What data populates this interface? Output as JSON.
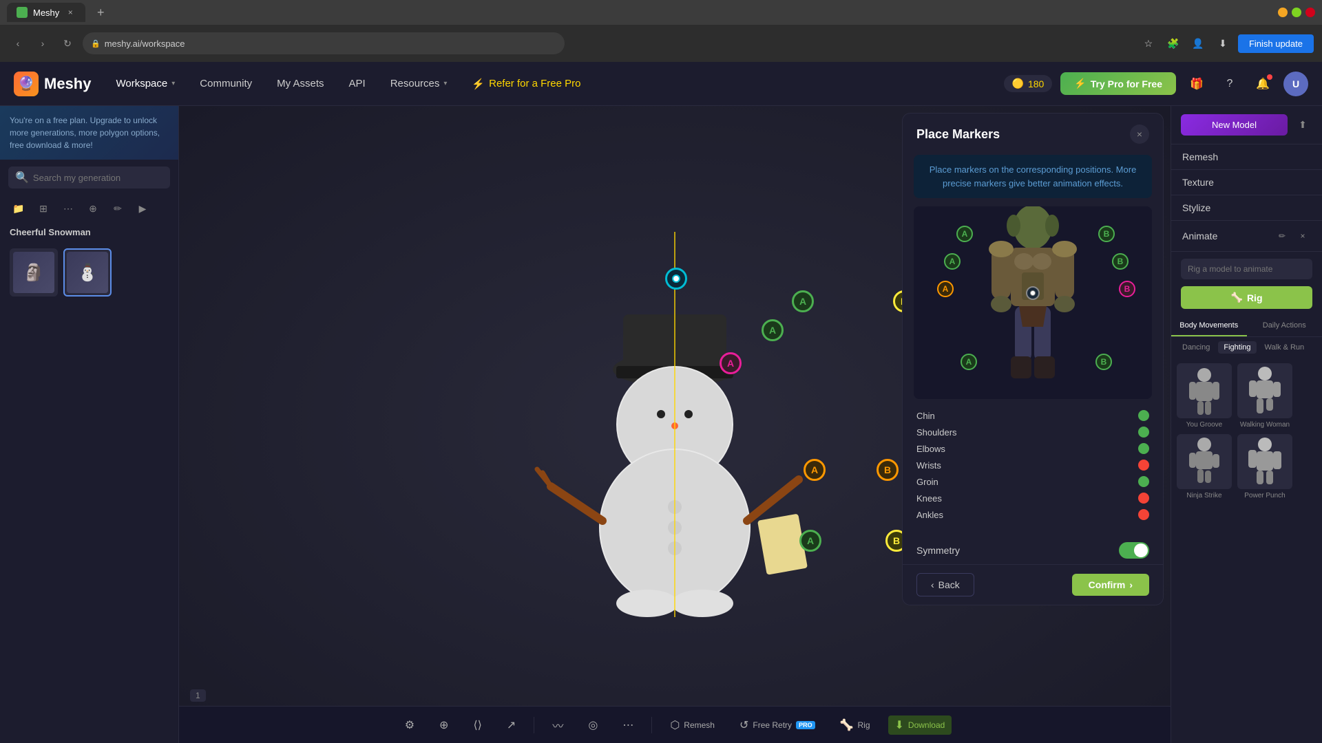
{
  "browser": {
    "tab_title": "Meshy",
    "url": "meshy.ai/workspace",
    "finish_update": "Finish update"
  },
  "header": {
    "logo_text": "Meshy",
    "nav": {
      "workspace": "Workspace",
      "community": "Community",
      "my_assets": "My Assets",
      "api": "API",
      "resources": "Resources",
      "refer": "Refer for a Free Pro"
    },
    "coins": "180",
    "try_pro": "Try Pro for Free"
  },
  "sidebar": {
    "upgrade_text": "You're on a free plan. Upgrade to unlock more generations, more polygon options, free download & more!",
    "search_placeholder": "Search my generation",
    "model_name": "Cheerful Snowman"
  },
  "modal": {
    "title": "Place Markers",
    "instruction": "Place markers on the corresponding positions. More precise markers give better animation effects.",
    "close_icon": "×",
    "markers": [
      {
        "label": "Chin",
        "status": "green"
      },
      {
        "label": "Shoulders",
        "status": "green"
      },
      {
        "label": "Elbows",
        "status": "green"
      },
      {
        "label": "Wrists",
        "status": "red"
      },
      {
        "label": "Groin",
        "status": "green"
      },
      {
        "label": "Knees",
        "status": "red"
      },
      {
        "label": "Ankles",
        "status": "red"
      }
    ],
    "symmetry_label": "Symmetry",
    "back_label": "Back",
    "confirm_label": "Confirm"
  },
  "right_panel": {
    "new_model": "New Model",
    "menu_items": [
      "Remesh",
      "Texture",
      "Stylize"
    ],
    "animate_label": "Animate",
    "rig_placeholder": "Rig a model to animate",
    "rig_btn": "Rig",
    "anim_tabs": [
      "Body Movements",
      "Daily Actions"
    ],
    "anim_subtabs": [
      "Dancing",
      "Fighting",
      "Walk & Run"
    ],
    "animation_previews": [
      {
        "label": "You Groove"
      },
      {
        "label": "Walking Woman"
      }
    ]
  },
  "viewport": {
    "toolbar_items": [
      "Remesh",
      "Free Retry",
      "Rig",
      "Download"
    ],
    "page": "1"
  }
}
